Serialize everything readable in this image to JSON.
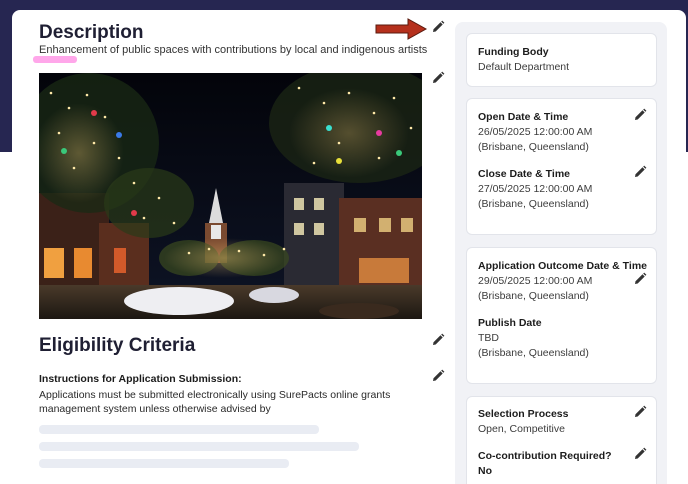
{
  "description": {
    "title": "Description",
    "text": "Enhancement of public spaces with contributions by local and indigenous artists"
  },
  "eligibility": {
    "title": "Eligibility Criteria",
    "instructions_title": "Instructions for Application Submission:",
    "instructions_text": "Applications must be submitted electronically using SurePacts online grants management system unless otherwise advised by"
  },
  "sidebar": {
    "funding_body": {
      "label": "Funding Body",
      "value": "Default Department"
    },
    "open_date": {
      "label": "Open Date & Time",
      "value": "26/05/2025 12:00:00 AM",
      "tz": "(Brisbane, Queensland)"
    },
    "close_date": {
      "label": "Close Date & Time",
      "value": "27/05/2025 12:00:00 AM",
      "tz": "(Brisbane, Queensland)"
    },
    "outcome_date": {
      "label": "Application Outcome Date & Time",
      "value": "29/05/2025 12:00:00 AM",
      "tz": "(Brisbane, Queensland)"
    },
    "publish_date": {
      "label": "Publish Date",
      "value": "TBD",
      "tz": "(Brisbane, Queensland)"
    },
    "selection_process": {
      "label": "Selection Process",
      "value": "Open, Competitive"
    },
    "cocontribution": {
      "label": "Co-contribution Required?",
      "value": "No"
    }
  },
  "icons": {
    "edit": "pencil-icon",
    "arrow": "red-arrow-annotation"
  },
  "colors": {
    "header_band": "#262651",
    "arrow": "#b5301c",
    "highlight": "#ff5fd8",
    "panel_bg": "#f1f2f6"
  }
}
